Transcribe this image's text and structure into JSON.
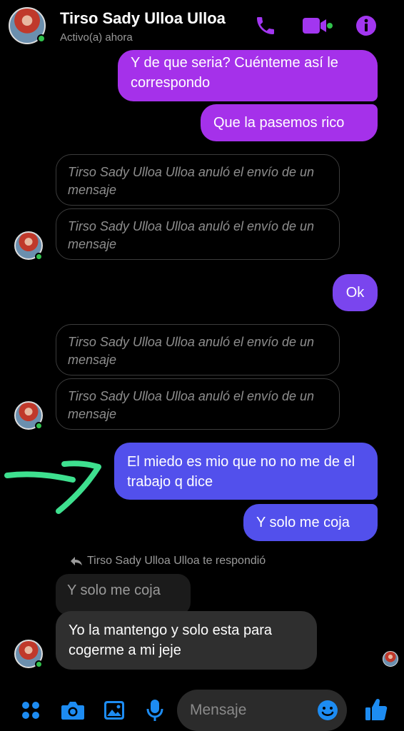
{
  "header": {
    "name": "Tirso Sady Ulloa Ulloa",
    "status": "Activo(a) ahora"
  },
  "messages": {
    "m1": "Y de que seria? Cuénteme así le correspondo",
    "m2": "Que la pasemos rico",
    "unsent": "Tirso Sady Ulloa Ulloa anuló el envío de un mensaje",
    "m3": "Ok",
    "m4": "El miedo es mio  que no no me de el trabajo q dice",
    "m5": "Y solo me coja",
    "reply_note": "Tirso Sady Ulloa Ulloa te respondió",
    "quoted": "Y solo me coja",
    "m6": "Yo la mantengo y solo esta para cogerme a mi jeje"
  },
  "composer": {
    "placeholder": "Mensaje"
  },
  "icons": [
    "phone-icon",
    "video-icon",
    "info-icon",
    "apps-icon",
    "camera-icon",
    "gallery-icon",
    "microphone-icon",
    "emoji-icon",
    "like-icon",
    "reply-arrow-icon"
  ],
  "colors": {
    "accent": "#a236f0",
    "bubble_purple": "#a531ea",
    "bubble_violet": "#7a45ee",
    "bubble_blue": "#5250ec",
    "online": "#31c24d",
    "annotation_arrow": "#3ee08f"
  }
}
